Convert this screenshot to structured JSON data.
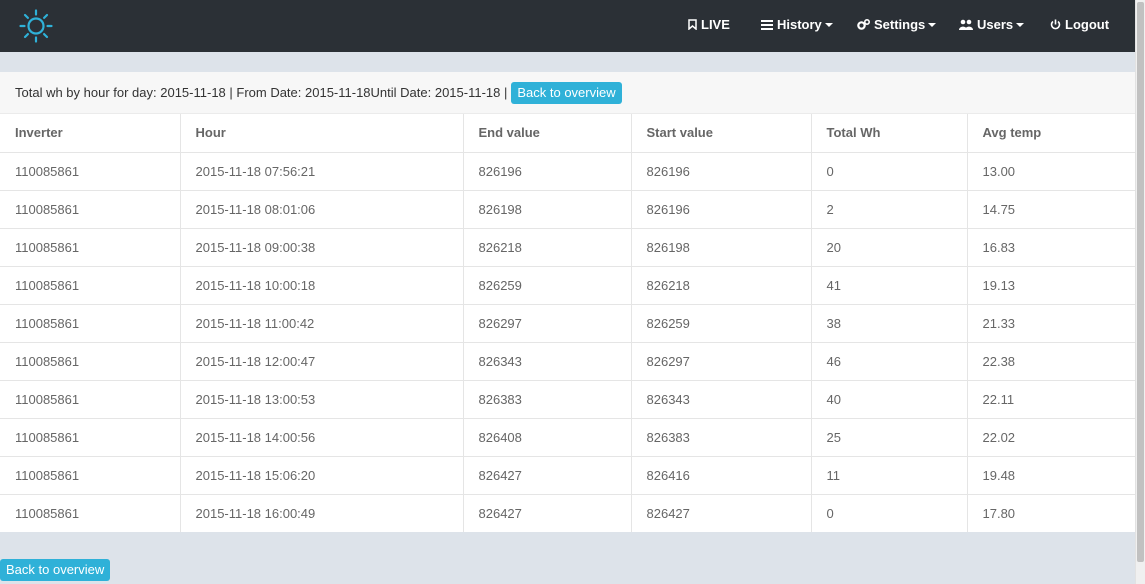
{
  "nav": {
    "logo_icon": "sun-icon",
    "items": [
      {
        "label": "LIVE",
        "icon": "bookmark-icon",
        "dropdown": false
      },
      {
        "label": "History",
        "icon": "list-icon",
        "dropdown": true
      },
      {
        "label": "Settings",
        "icon": "gears-icon",
        "dropdown": true
      },
      {
        "label": "Users",
        "icon": "users-icon",
        "dropdown": true
      },
      {
        "label": "Logout",
        "icon": "power-icon",
        "dropdown": false
      }
    ]
  },
  "panel": {
    "heading_text": "Total wh by hour for day: 2015-11-18 | From Date: 2015-11-18Until Date: 2015-11-18 |",
    "back_button_label": "Back to overview"
  },
  "table": {
    "columns": [
      "Inverter",
      "Hour",
      "End value",
      "Start value",
      "Total Wh",
      "Avg temp"
    ],
    "rows": [
      [
        "110085861",
        "2015-11-18 07:56:21",
        "826196",
        "826196",
        "0",
        "13.00"
      ],
      [
        "110085861",
        "2015-11-18 08:01:06",
        "826198",
        "826196",
        "2",
        "14.75"
      ],
      [
        "110085861",
        "2015-11-18 09:00:38",
        "826218",
        "826198",
        "20",
        "16.83"
      ],
      [
        "110085861",
        "2015-11-18 10:00:18",
        "826259",
        "826218",
        "41",
        "19.13"
      ],
      [
        "110085861",
        "2015-11-18 11:00:42",
        "826297",
        "826259",
        "38",
        "21.33"
      ],
      [
        "110085861",
        "2015-11-18 12:00:47",
        "826343",
        "826297",
        "46",
        "22.38"
      ],
      [
        "110085861",
        "2015-11-18 13:00:53",
        "826383",
        "826343",
        "40",
        "22.11"
      ],
      [
        "110085861",
        "2015-11-18 14:00:56",
        "826408",
        "826383",
        "25",
        "22.02"
      ],
      [
        "110085861",
        "2015-11-18 15:06:20",
        "826427",
        "826416",
        "11",
        "19.48"
      ],
      [
        "110085861",
        "2015-11-18 16:00:49",
        "826427",
        "826427",
        "0",
        "17.80"
      ]
    ]
  },
  "footer": {
    "back_button_label": "Back to overview"
  },
  "colors": {
    "navbar": "#2b3036",
    "accent": "#2fb1d8",
    "background": "#dde3ea",
    "logo": "#2fb1d8"
  }
}
